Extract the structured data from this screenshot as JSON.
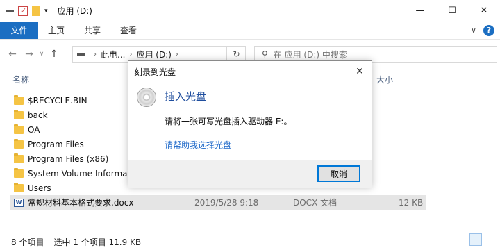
{
  "window": {
    "title": "应用 (D:)",
    "minimize": "—",
    "maximize": "☐",
    "close": "✕"
  },
  "ribbon": {
    "tabs": [
      "文件",
      "主页",
      "共享",
      "查看"
    ],
    "expand": "∨",
    "help": "?"
  },
  "address": {
    "parts": [
      "此电...",
      "应用 (D:)"
    ],
    "search_placeholder": "在 应用 (D:) 中搜索"
  },
  "columns": {
    "name": "名称",
    "size": "大小"
  },
  "files": [
    {
      "name": "$RECYCLE.BIN",
      "type": "folder"
    },
    {
      "name": "back",
      "type": "folder"
    },
    {
      "name": "OA",
      "type": "folder"
    },
    {
      "name": "Program Files",
      "type": "folder"
    },
    {
      "name": "Program Files (x86)",
      "type": "folder"
    },
    {
      "name": "System Volume Informati",
      "type": "folder"
    },
    {
      "name": "Users",
      "type": "folder"
    },
    {
      "name": "常规材料基本格式要求.docx",
      "type": "docx",
      "date": "2019/5/28 9:18",
      "kind": "DOCX 文档",
      "size": "12 KB",
      "selected": true
    }
  ],
  "status": {
    "count": "8 个项目",
    "selection": "选中 1 个项目  11.9 KB"
  },
  "dialog": {
    "title": "刻录到光盘",
    "close": "✕",
    "heading": "插入光盘",
    "message": "请将一张可写光盘插入驱动器 E:。",
    "link": "请帮助我选择光盘",
    "cancel": "取消"
  },
  "colors": {
    "accent": "#1b6ec2",
    "dialog_heading": "#1f4e9e",
    "link": "#1a66c8",
    "folder": "#f5c444"
  }
}
